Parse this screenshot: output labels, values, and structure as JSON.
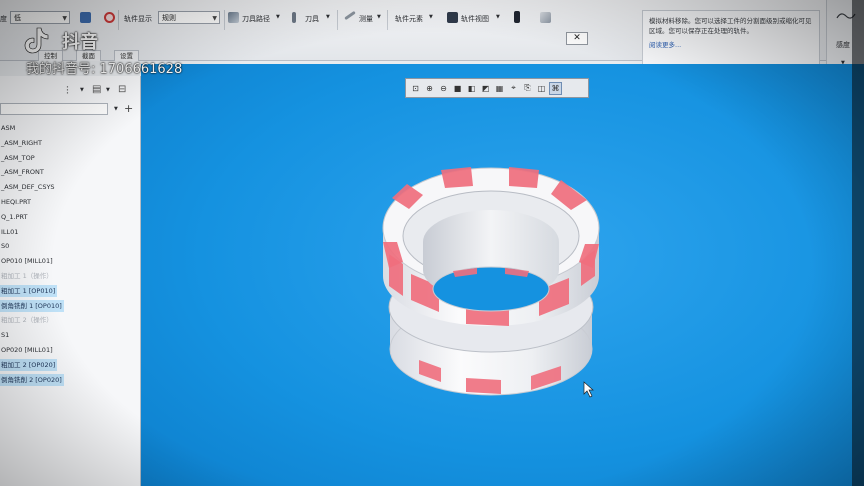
{
  "watermark": {
    "app_name": "抖音",
    "account_id": "我的抖音号: 1706661628"
  },
  "ribbon": {
    "quality_label": "度",
    "quality_value": "低",
    "path_display_label": "轨件显示",
    "path_display_value": "规则",
    "toolpath_label": "刀具路径",
    "tool_label": "刀具",
    "measure_label": "测量",
    "path_element_label": "轨件元素",
    "path_view_label": "轨件视图",
    "close_glyph": "✕",
    "tabs": [
      "控制",
      "截面",
      "设置"
    ],
    "side_label": "感度"
  },
  "hint": {
    "text": "模拟材料移除。您可以选择工件的分割面级别或缩化可见区域。您可以保存正在处理的轨件。",
    "more_link": "阅读更多..."
  },
  "tree": {
    "items": [
      {
        "label": "ASM",
        "state": "normal"
      },
      {
        "label": "_ASM_RIGHT",
        "state": "normal"
      },
      {
        "label": "_ASM_TOP",
        "state": "normal"
      },
      {
        "label": "_ASM_FRONT",
        "state": "normal"
      },
      {
        "label": "_ASM_DEF_CSYS",
        "state": "normal"
      },
      {
        "label": "HEQI.PRT",
        "state": "normal"
      },
      {
        "label": "Q_1.PRT",
        "state": "normal"
      },
      {
        "label": "ILL01",
        "state": "normal"
      },
      {
        "label": "S0",
        "state": "normal"
      },
      {
        "label": "OP010 [MILL01]",
        "state": "normal"
      },
      {
        "label": "粗加工 1（操作）",
        "state": "dim"
      },
      {
        "label": "粗加工 1 [OP010]",
        "state": "highlight"
      },
      {
        "label": "倒角铣削 1 [OP010]",
        "state": "highlight"
      },
      {
        "label": "粗加工 2（操作）",
        "state": "dim"
      },
      {
        "label": "S1",
        "state": "normal"
      },
      {
        "label": "OP020 [MILL01]",
        "state": "normal"
      },
      {
        "label": "粗加工 2 [OP020]",
        "state": "highlight"
      },
      {
        "label": "倒角铣削 2 [OP020]",
        "state": "highlight"
      }
    ]
  },
  "viewport": {
    "background": "#1592e0",
    "part_color": "#f2f2f4",
    "highlight_color": "#f06f7e",
    "view_toolbar_icons": [
      "refit-icon",
      "zoom-in-icon",
      "zoom-out-icon",
      "shaded-icon",
      "hidden-line-icon",
      "no-hidden-icon",
      "wireframe-icon",
      "datum-display-icon",
      "saved-views-icon",
      "render-icon",
      "spin-center-icon"
    ]
  }
}
